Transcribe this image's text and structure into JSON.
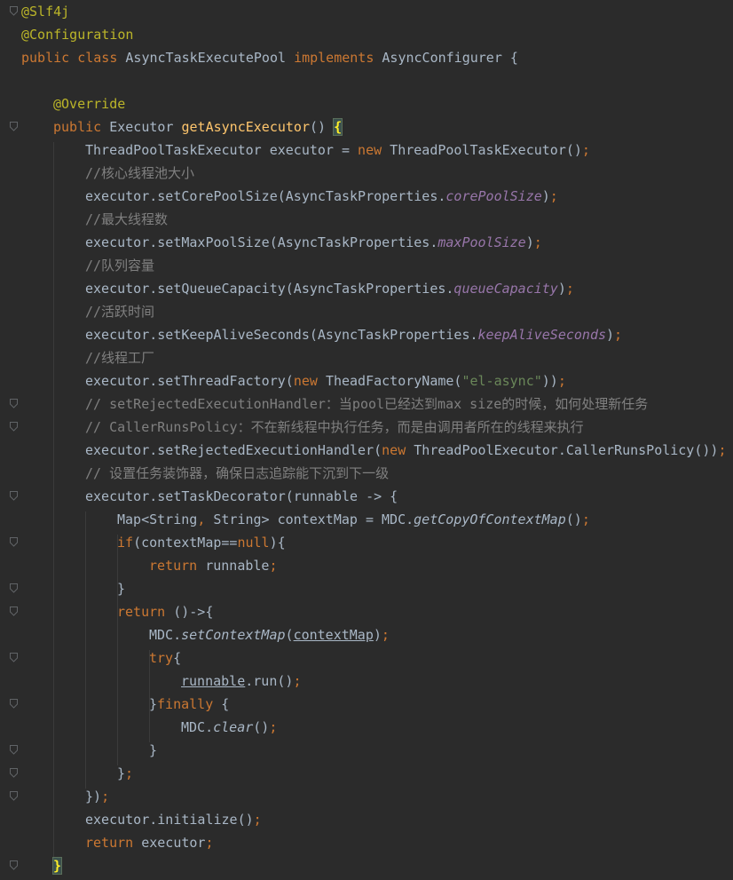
{
  "editor": {
    "lines": [
      {
        "indent": 0,
        "tokens": [
          {
            "c": "ann",
            "t": "@Slf4j"
          }
        ]
      },
      {
        "indent": 0,
        "tokens": [
          {
            "c": "ann",
            "t": "@Configuration"
          }
        ]
      },
      {
        "indent": 0,
        "tokens": [
          {
            "c": "kw",
            "t": "public class "
          },
          {
            "c": "",
            "t": "AsyncTaskExecutePool "
          },
          {
            "c": "kw",
            "t": "implements "
          },
          {
            "c": "",
            "t": "AsyncConfigurer {"
          }
        ]
      },
      {
        "indent": 0,
        "tokens": []
      },
      {
        "indent": 1,
        "tokens": [
          {
            "c": "ann",
            "t": "@Override"
          }
        ]
      },
      {
        "indent": 1,
        "tokens": [
          {
            "c": "kw",
            "t": "public "
          },
          {
            "c": "",
            "t": "Executor "
          },
          {
            "c": "fn",
            "t": "getAsyncExecutor"
          },
          {
            "c": "",
            "t": "() "
          },
          {
            "c": "brace-hl",
            "t": "{"
          }
        ]
      },
      {
        "indent": 2,
        "tokens": [
          {
            "c": "",
            "t": "ThreadPoolTaskExecutor executor = "
          },
          {
            "c": "kw",
            "t": "new "
          },
          {
            "c": "",
            "t": "ThreadPoolTaskExecutor()"
          },
          {
            "c": "kw",
            "t": ";"
          }
        ]
      },
      {
        "indent": 2,
        "tokens": [
          {
            "c": "cm",
            "t": "//核心线程池大小"
          }
        ]
      },
      {
        "indent": 2,
        "tokens": [
          {
            "c": "",
            "t": "executor.setCorePoolSize(AsyncTaskProperties."
          },
          {
            "c": "fld",
            "t": "corePoolSize"
          },
          {
            "c": "",
            "t": ")"
          },
          {
            "c": "kw",
            "t": ";"
          }
        ]
      },
      {
        "indent": 2,
        "tokens": [
          {
            "c": "cm",
            "t": "//最大线程数"
          }
        ]
      },
      {
        "indent": 2,
        "tokens": [
          {
            "c": "",
            "t": "executor.setMaxPoolSize(AsyncTaskProperties."
          },
          {
            "c": "fld",
            "t": "maxPoolSize"
          },
          {
            "c": "",
            "t": ")"
          },
          {
            "c": "kw",
            "t": ";"
          }
        ]
      },
      {
        "indent": 2,
        "tokens": [
          {
            "c": "cm",
            "t": "//队列容量"
          }
        ]
      },
      {
        "indent": 2,
        "tokens": [
          {
            "c": "",
            "t": "executor.setQueueCapacity(AsyncTaskProperties."
          },
          {
            "c": "fld",
            "t": "queueCapacity"
          },
          {
            "c": "",
            "t": ")"
          },
          {
            "c": "kw",
            "t": ";"
          }
        ]
      },
      {
        "indent": 2,
        "tokens": [
          {
            "c": "cm",
            "t": "//活跃时间"
          }
        ]
      },
      {
        "indent": 2,
        "tokens": [
          {
            "c": "",
            "t": "executor.setKeepAliveSeconds(AsyncTaskProperties."
          },
          {
            "c": "fld",
            "t": "keepAliveSeconds"
          },
          {
            "c": "",
            "t": ")"
          },
          {
            "c": "kw",
            "t": ";"
          }
        ]
      },
      {
        "indent": 2,
        "tokens": [
          {
            "c": "cm",
            "t": "//线程工厂"
          }
        ]
      },
      {
        "indent": 2,
        "tokens": [
          {
            "c": "",
            "t": "executor.setThreadFactory("
          },
          {
            "c": "kw",
            "t": "new "
          },
          {
            "c": "",
            "t": "TheadFactoryName("
          },
          {
            "c": "st",
            "t": "\"el-async\""
          },
          {
            "c": "",
            "t": "))"
          },
          {
            "c": "kw",
            "t": ";"
          }
        ]
      },
      {
        "indent": 2,
        "tokens": [
          {
            "c": "cm",
            "t": "// setRejectedExecutionHandler：当pool已经达到max size的时候，如何处理新任务"
          }
        ]
      },
      {
        "indent": 2,
        "tokens": [
          {
            "c": "cm",
            "t": "// CallerRunsPolicy：不在新线程中执行任务，而是由调用者所在的线程来执行"
          }
        ]
      },
      {
        "indent": 2,
        "tokens": [
          {
            "c": "",
            "t": "executor.setRejectedExecutionHandler("
          },
          {
            "c": "kw",
            "t": "new "
          },
          {
            "c": "",
            "t": "ThreadPoolExecutor.CallerRunsPolicy())"
          },
          {
            "c": "kw",
            "t": ";"
          }
        ]
      },
      {
        "indent": 2,
        "tokens": [
          {
            "c": "cm",
            "t": "// 设置任务装饰器，确保日志追踪能下沉到下一级"
          }
        ]
      },
      {
        "indent": 2,
        "tokens": [
          {
            "c": "",
            "t": "executor.setTaskDecorator(runnable -> {"
          }
        ]
      },
      {
        "indent": 3,
        "tokens": [
          {
            "c": "",
            "t": "Map<String"
          },
          {
            "c": "kw",
            "t": ", "
          },
          {
            "c": "",
            "t": "String> contextMap = MDC."
          },
          {
            "c": "ital",
            "t": "getCopyOfContextMap"
          },
          {
            "c": "",
            "t": "()"
          },
          {
            "c": "kw",
            "t": ";"
          }
        ]
      },
      {
        "indent": 3,
        "tokens": [
          {
            "c": "kw",
            "t": "if"
          },
          {
            "c": "",
            "t": "(contextMap=="
          },
          {
            "c": "kw",
            "t": "null"
          },
          {
            "c": "",
            "t": "){"
          }
        ]
      },
      {
        "indent": 4,
        "tokens": [
          {
            "c": "kw",
            "t": "return "
          },
          {
            "c": "",
            "t": "runnable"
          },
          {
            "c": "kw",
            "t": ";"
          }
        ]
      },
      {
        "indent": 3,
        "tokens": [
          {
            "c": "",
            "t": "}"
          }
        ]
      },
      {
        "indent": 3,
        "tokens": [
          {
            "c": "kw",
            "t": "return "
          },
          {
            "c": "",
            "t": "()->{"
          }
        ]
      },
      {
        "indent": 4,
        "tokens": [
          {
            "c": "",
            "t": "MDC."
          },
          {
            "c": "ital",
            "t": "setContextMap"
          },
          {
            "c": "",
            "t": "("
          },
          {
            "c": "ul",
            "t": "contextMap"
          },
          {
            "c": "",
            "t": ")"
          },
          {
            "c": "kw",
            "t": ";"
          }
        ]
      },
      {
        "indent": 4,
        "tokens": [
          {
            "c": "kw",
            "t": "try"
          },
          {
            "c": "",
            "t": "{"
          }
        ]
      },
      {
        "indent": 5,
        "tokens": [
          {
            "c": "ul",
            "t": "runnable"
          },
          {
            "c": "",
            "t": ".run()"
          },
          {
            "c": "kw",
            "t": ";"
          }
        ]
      },
      {
        "indent": 4,
        "tokens": [
          {
            "c": "",
            "t": "}"
          },
          {
            "c": "kw",
            "t": "finally "
          },
          {
            "c": "",
            "t": "{"
          }
        ]
      },
      {
        "indent": 5,
        "tokens": [
          {
            "c": "",
            "t": "MDC."
          },
          {
            "c": "ital",
            "t": "clear"
          },
          {
            "c": "",
            "t": "()"
          },
          {
            "c": "kw",
            "t": ";"
          }
        ]
      },
      {
        "indent": 4,
        "tokens": [
          {
            "c": "",
            "t": "}"
          }
        ]
      },
      {
        "indent": 3,
        "tokens": [
          {
            "c": "",
            "t": "}"
          },
          {
            "c": "kw",
            "t": ";"
          }
        ]
      },
      {
        "indent": 2,
        "tokens": [
          {
            "c": "",
            "t": "})"
          },
          {
            "c": "kw",
            "t": ";"
          }
        ]
      },
      {
        "indent": 2,
        "tokens": [
          {
            "c": "",
            "t": "executor.initialize()"
          },
          {
            "c": "kw",
            "t": ";"
          }
        ]
      },
      {
        "indent": 2,
        "tokens": [
          {
            "c": "kw",
            "t": "return "
          },
          {
            "c": "",
            "t": "executor"
          },
          {
            "c": "kw",
            "t": ";"
          }
        ]
      },
      {
        "indent": 1,
        "tokens": [
          {
            "c": "brace-hl",
            "t": "}"
          }
        ]
      }
    ]
  },
  "gutter": {
    "fold_markers": [
      "fold-icon",
      "fold-icon",
      "fold-icon",
      "fold-icon",
      "fold-icon",
      "fold-icon",
      "fold-icon",
      "fold-icon",
      "fold-icon",
      "fold-icon",
      "fold-icon",
      "fold-icon",
      "fold-icon",
      "fold-icon"
    ]
  },
  "theme": {
    "background": "#2b2b2b",
    "keyword": "#cc7832",
    "annotation": "#bbb529",
    "method": "#ffc66d",
    "comment": "#808080",
    "string": "#6a8759",
    "field": "#9876aa",
    "text": "#a9b7c6"
  }
}
